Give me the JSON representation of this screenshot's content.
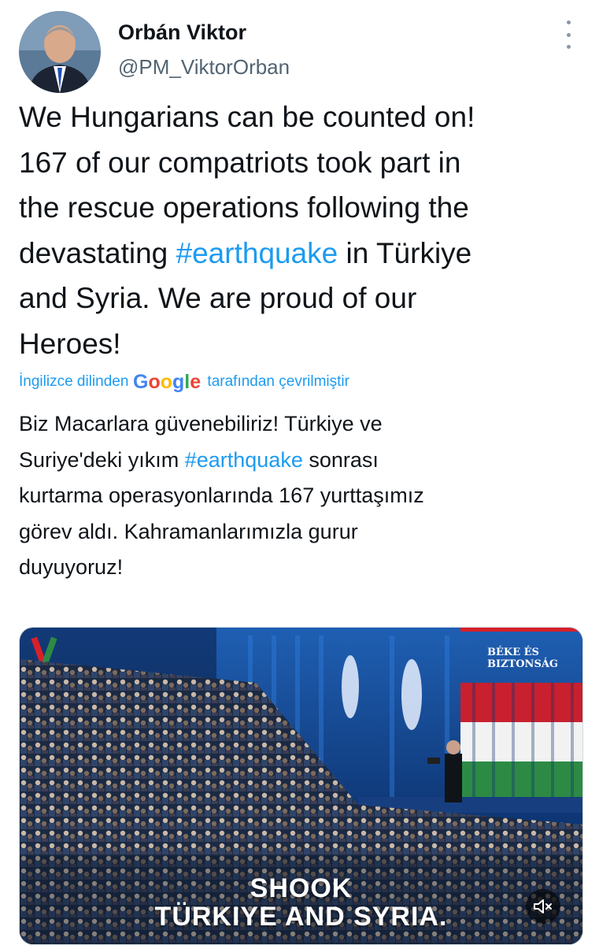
{
  "author": {
    "display_name": "Orbán Viktor",
    "handle": "@PM_ViktorOrban",
    "avatar_icon": "profile-photo"
  },
  "more_icon": "more-vertical-icon",
  "tweet": {
    "line1": "We Hungarians can be counted on!",
    "line2": "167 of our compatriots took part in",
    "line3": "the rescue operations following the",
    "line4_pre": "devastating ",
    "line4_hashtag": "#earthquake",
    "line4_post": " in Türkiye",
    "line5": "and Syria. We are proud of our",
    "line6": "Heroes!"
  },
  "translation": {
    "prefix": "İngilizce dilinden",
    "brand": "Google",
    "suffix": "tarafından çevrilmiştir",
    "line1": "Biz Macarlara güvenebiliriz! Türkiye ve",
    "line2_pre": "Suriye'deki yıkım ",
    "line2_hashtag": "#earthquake",
    "line2_post": " sonrası",
    "line3": "kurtarma operasyonlarında 167 yurttaşımız",
    "line4": "görev aldı. Kahramanlarımızla gurur",
    "line5": "duyuyoruz!"
  },
  "media": {
    "banner_text": "BÉKE ÉS BIZTONSÁG",
    "caption_line1": "SHOOK",
    "caption_line2": "TÜRKIYE AND SYRIA.",
    "mute_icon": "volume-muted-icon"
  },
  "colors": {
    "hashtag": "#1d9bf0",
    "text": "#0f1419",
    "secondary": "#536471"
  }
}
